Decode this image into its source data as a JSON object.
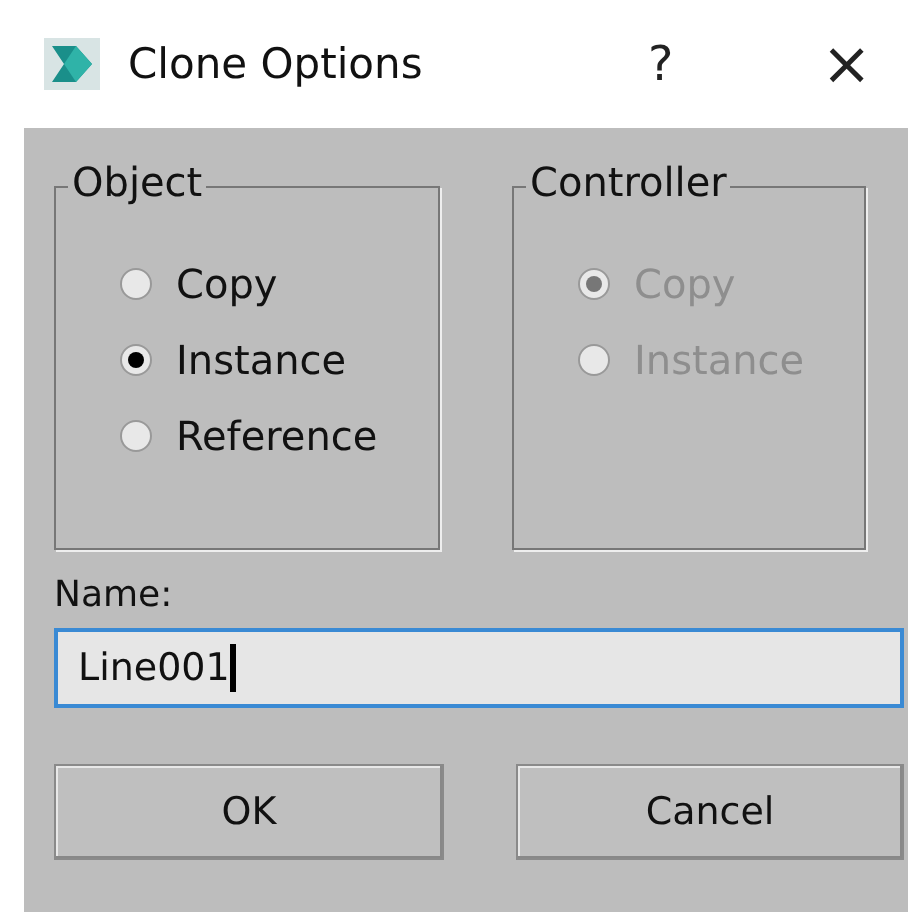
{
  "window": {
    "title": "Clone Options",
    "help": "?",
    "close": "×"
  },
  "groups": [
    {
      "title": "Object",
      "disabled": false,
      "options": [
        {
          "label": "Copy",
          "selected": false
        },
        {
          "label": "Instance",
          "selected": true
        },
        {
          "label": "Reference",
          "selected": false
        }
      ]
    },
    {
      "title": "Controller",
      "disabled": true,
      "options": [
        {
          "label": "Copy",
          "selected": true
        },
        {
          "label": "Instance",
          "selected": false
        }
      ]
    }
  ],
  "name_field": {
    "label": "Name:",
    "value": "Line001"
  },
  "buttons": [
    "OK",
    "Cancel"
  ]
}
